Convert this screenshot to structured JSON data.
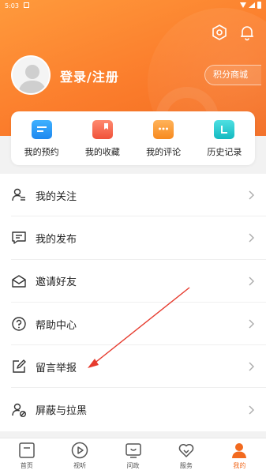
{
  "status_bar": {
    "time": "5:03"
  },
  "header": {
    "login_text": "登录/注册",
    "points_button": "积分商城",
    "icons": [
      "settings-icon",
      "bell-icon"
    ]
  },
  "quick_actions": [
    {
      "label": "我的预约",
      "icon": "calendar-icon",
      "color": "#2e9cf7"
    },
    {
      "label": "我的收藏",
      "icon": "bookmark-icon",
      "color": "#f26a4f"
    },
    {
      "label": "我的评论",
      "icon": "comment-icon",
      "color": "#f7971e"
    },
    {
      "label": "历史记录",
      "icon": "history-icon",
      "color": "#1fc6cc"
    }
  ],
  "menu": [
    {
      "label": "我的关注",
      "icon": "person-list-icon"
    },
    {
      "label": "我的发布",
      "icon": "post-icon"
    },
    {
      "label": "邀请好友",
      "icon": "envelope-icon"
    },
    {
      "label": "帮助中心",
      "icon": "help-icon"
    },
    {
      "label": "留言举报",
      "icon": "edit-icon"
    },
    {
      "label": "屏蔽与拉黑",
      "icon": "block-user-icon"
    }
  ],
  "tabs": [
    {
      "label": "首页",
      "icon": "home-icon",
      "active": false
    },
    {
      "label": "视听",
      "icon": "play-icon",
      "active": false
    },
    {
      "label": "问政",
      "icon": "tv-icon",
      "active": false
    },
    {
      "label": "服务",
      "icon": "heart-icon",
      "active": false
    },
    {
      "label": "我的",
      "icon": "user-icon",
      "active": true
    }
  ],
  "colors": {
    "accent": "#f26a1f",
    "arrow": "#e63b2e"
  }
}
